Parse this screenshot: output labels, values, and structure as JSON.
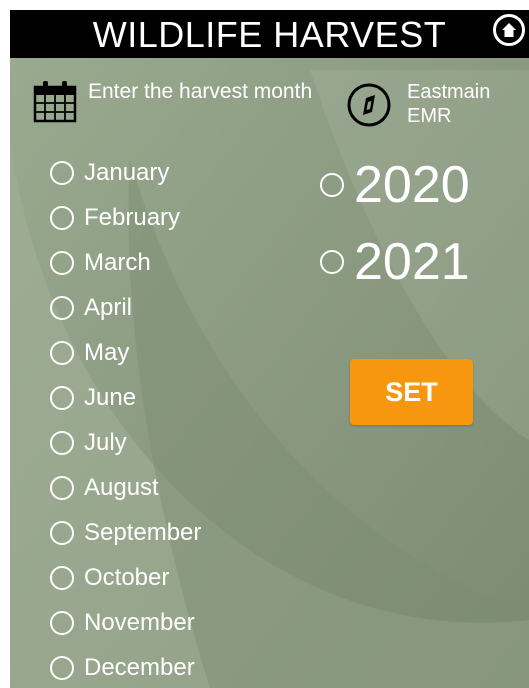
{
  "header": {
    "title": "WILDLIFE HARVEST"
  },
  "prompt": {
    "month_label": "Enter the harvest month"
  },
  "location": {
    "line1": "Eastmain",
    "line2": "EMR"
  },
  "months": [
    "January",
    "February",
    "March",
    "April",
    "May",
    "June",
    "July",
    "August",
    "September",
    "October",
    "November",
    "December"
  ],
  "years": [
    "2020",
    "2021"
  ],
  "actions": {
    "set_label": "SET"
  },
  "colors": {
    "header_bg": "#000000",
    "background": "#8f9f86",
    "set_button": "#f7960f"
  },
  "icons": {
    "home": "home-icon",
    "calendar": "calendar-icon",
    "compass": "compass-icon"
  }
}
